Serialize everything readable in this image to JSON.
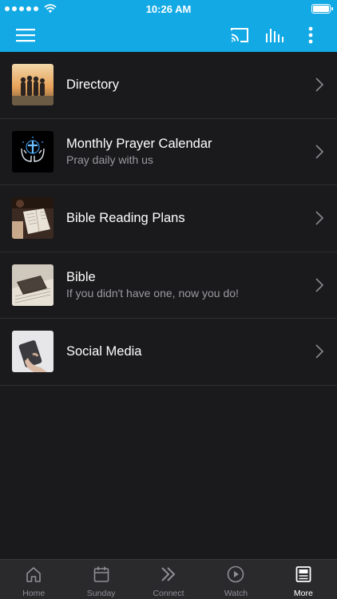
{
  "status_bar": {
    "time": "10:26 AM",
    "battery_level": 1.0
  },
  "colors": {
    "accent": "#13a9e4",
    "background": "#1a1a1c",
    "tab_bar": "#2a2a2d",
    "active_tab": "#ffffff",
    "inactive_tab": "#8f8f94"
  },
  "toolbar": {
    "menu_icon": "hamburger-icon",
    "cast_icon": "cast-icon",
    "audio_icon": "audio-bars-icon",
    "more_icon": "vertical-dots-icon"
  },
  "list": {
    "items": [
      {
        "title": "Directory",
        "subtitle": "",
        "icon": "people-photo-thumbnail"
      },
      {
        "title": "Monthly Prayer Calendar",
        "subtitle": "Pray daily with us",
        "icon": "praying-hands-thumbnail"
      },
      {
        "title": "Bible Reading Plans",
        "subtitle": "",
        "icon": "open-book-thumbnail"
      },
      {
        "title": "Bible",
        "subtitle": "If you didn't have one, now you do!",
        "icon": "bible-photo-thumbnail"
      },
      {
        "title": "Social Media",
        "subtitle": "",
        "icon": "phone-hand-thumbnail"
      }
    ]
  },
  "tabs": [
    {
      "label": "Home",
      "icon": "home-icon",
      "active": false
    },
    {
      "label": "Sunday",
      "icon": "calendar-icon",
      "active": false
    },
    {
      "label": "Connect",
      "icon": "double-chevron-icon",
      "active": false
    },
    {
      "label": "Watch",
      "icon": "play-circle-icon",
      "active": false
    },
    {
      "label": "More",
      "icon": "more-list-icon",
      "active": true
    }
  ]
}
